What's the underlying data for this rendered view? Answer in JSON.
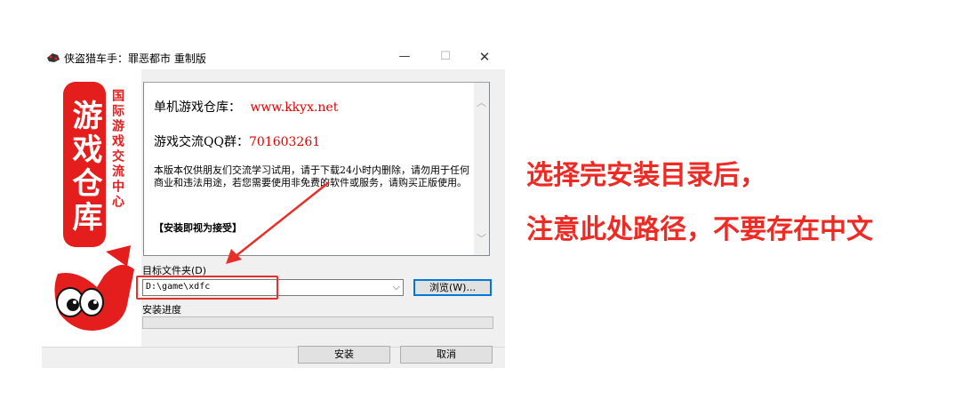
{
  "window": {
    "title": "侠盗猎车手：罪恶都市 重制版",
    "minimize": "—",
    "maximize": "☐",
    "close": "✕"
  },
  "logo": {
    "brand_text": "游戏仓库",
    "sub_text": "国际游戏交流中心",
    "mascot": "KK"
  },
  "info": {
    "warehouse_label": "单机游戏仓库：",
    "warehouse_url": "www.kkyx.net",
    "qq_label": "游戏交流QQ群：",
    "qq_number": "701603261",
    "notice": "本版本仅供朋友们交流学习试用，请于下载24小时内删除，请勿用于任何商业和违法用途，若您需要使用非免费的软件或服务，请购买正版使用。",
    "accept": "【安装即视为接受】"
  },
  "target": {
    "label": "目标文件夹(D)",
    "path_value": "D:\\game\\xdfc",
    "browse_label": "浏览(W)..."
  },
  "progress": {
    "label": "安装进度",
    "value": 0
  },
  "buttons": {
    "install": "安装",
    "cancel": "取消"
  },
  "annotation": {
    "line1": "选择完安装目录后，",
    "line2": "注意此处路径，不要存在中文",
    "color": "#ee2a24"
  }
}
